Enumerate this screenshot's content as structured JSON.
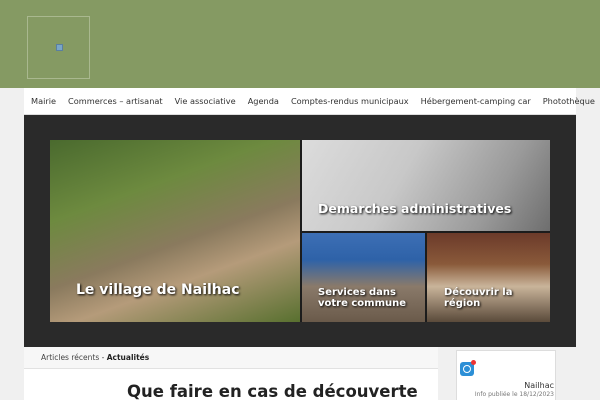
{
  "header": {
    "logo_alt": ""
  },
  "nav": {
    "items": [
      "Mairie",
      "Commerces – artisanat",
      "Vie associative",
      "Agenda",
      "Comptes-rendus municipaux",
      "Hébergement-camping car",
      "Photothèque"
    ]
  },
  "slider": {
    "tiles": [
      {
        "caption": "Le village de Nailhac"
      },
      {
        "caption": "Demarches administratives"
      },
      {
        "caption": "Services dans votre commune"
      },
      {
        "caption": "Découvrir la région"
      }
    ]
  },
  "breadcrumb": {
    "prefix": "Articles récents",
    "separator": " - ",
    "current": "Actualités"
  },
  "post": {
    "title": "Que faire en cas de découverte"
  },
  "sidebar": {
    "name": "Nailhac",
    "info": "Info publiée le 18/12/2023"
  },
  "colors": {
    "header_bg": "#859a63",
    "slider_bg": "#2a2a2a"
  }
}
